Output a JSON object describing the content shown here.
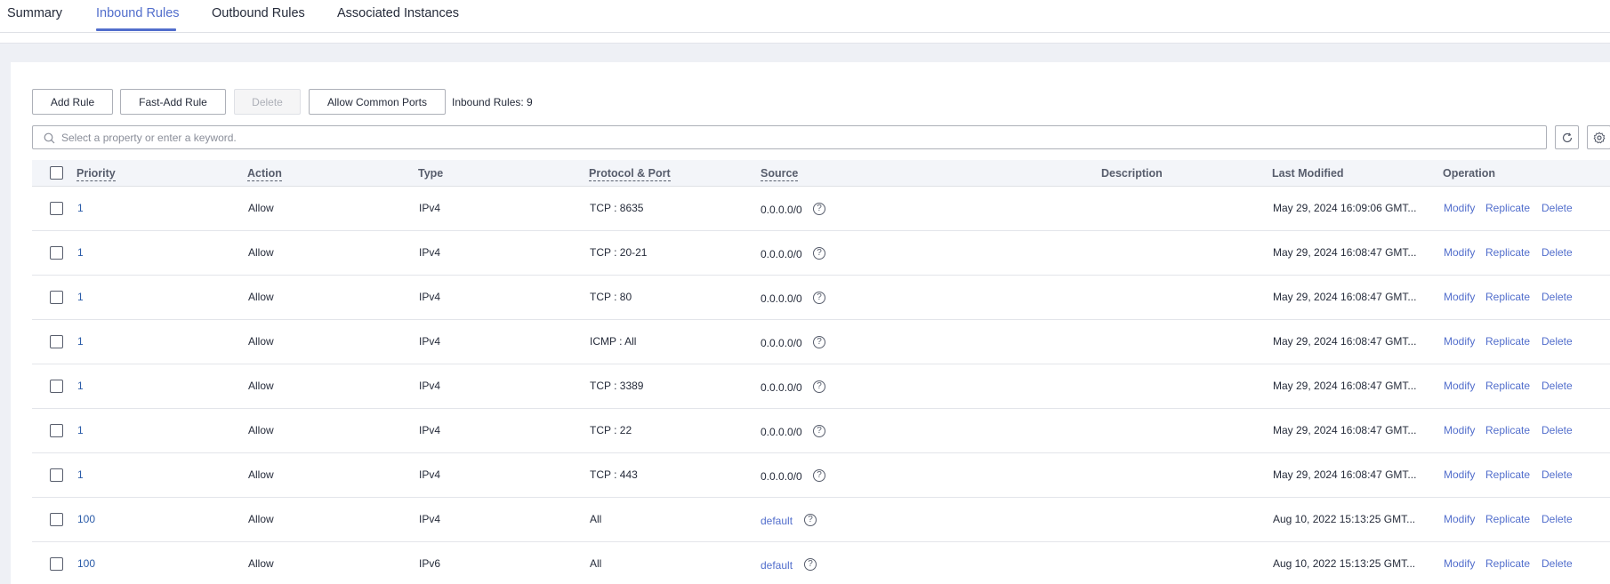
{
  "tabs": [
    {
      "label": "Summary",
      "active": false
    },
    {
      "label": "Inbound Rules",
      "active": true
    },
    {
      "label": "Outbound Rules",
      "active": false
    },
    {
      "label": "Associated Instances",
      "active": false
    }
  ],
  "toolbar": {
    "add_rule": "Add Rule",
    "fast_add_rule": "Fast-Add Rule",
    "delete": "Delete",
    "allow_common_ports": "Allow Common Ports",
    "rules_count": "Inbound Rules: 9"
  },
  "search": {
    "placeholder": "Select a property or enter a keyword."
  },
  "table": {
    "headers": {
      "priority": "Priority",
      "action": "Action",
      "type": "Type",
      "protocol_port": "Protocol & Port",
      "source": "Source",
      "description": "Description",
      "last_modified": "Last Modified",
      "operation": "Operation"
    },
    "operations": {
      "modify": "Modify",
      "replicate": "Replicate",
      "delete": "Delete"
    },
    "rows": [
      {
        "priority": "1",
        "action": "Allow",
        "type": "IPv4",
        "protocol_port": "TCP : 8635",
        "source": "0.0.0.0/0",
        "source_is_link": false,
        "description": "",
        "last_modified": "May 29, 2024 16:09:06 GMT..."
      },
      {
        "priority": "1",
        "action": "Allow",
        "type": "IPv4",
        "protocol_port": "TCP : 20-21",
        "source": "0.0.0.0/0",
        "source_is_link": false,
        "description": "",
        "last_modified": "May 29, 2024 16:08:47 GMT..."
      },
      {
        "priority": "1",
        "action": "Allow",
        "type": "IPv4",
        "protocol_port": "TCP : 80",
        "source": "0.0.0.0/0",
        "source_is_link": false,
        "description": "",
        "last_modified": "May 29, 2024 16:08:47 GMT..."
      },
      {
        "priority": "1",
        "action": "Allow",
        "type": "IPv4",
        "protocol_port": "ICMP : All",
        "source": "0.0.0.0/0",
        "source_is_link": false,
        "description": "",
        "last_modified": "May 29, 2024 16:08:47 GMT..."
      },
      {
        "priority": "1",
        "action": "Allow",
        "type": "IPv4",
        "protocol_port": "TCP : 3389",
        "source": "0.0.0.0/0",
        "source_is_link": false,
        "description": "",
        "last_modified": "May 29, 2024 16:08:47 GMT..."
      },
      {
        "priority": "1",
        "action": "Allow",
        "type": "IPv4",
        "protocol_port": "TCP : 22",
        "source": "0.0.0.0/0",
        "source_is_link": false,
        "description": "",
        "last_modified": "May 29, 2024 16:08:47 GMT..."
      },
      {
        "priority": "1",
        "action": "Allow",
        "type": "IPv4",
        "protocol_port": "TCP : 443",
        "source": "0.0.0.0/0",
        "source_is_link": false,
        "description": "",
        "last_modified": "May 29, 2024 16:08:47 GMT..."
      },
      {
        "priority": "100",
        "action": "Allow",
        "type": "IPv4",
        "protocol_port": "All",
        "source": "default",
        "source_is_link": true,
        "description": "",
        "last_modified": "Aug 10, 2022 15:13:25 GMT..."
      },
      {
        "priority": "100",
        "action": "Allow",
        "type": "IPv6",
        "protocol_port": "All",
        "source": "default",
        "source_is_link": true,
        "description": "",
        "last_modified": "Aug 10, 2022 15:13:25 GMT..."
      }
    ]
  },
  "colors": {
    "accent": "#526ecc",
    "priority_link": "#2a5ba8",
    "header_bg": "#f3f5f9",
    "band_bg": "#eef0f5"
  }
}
